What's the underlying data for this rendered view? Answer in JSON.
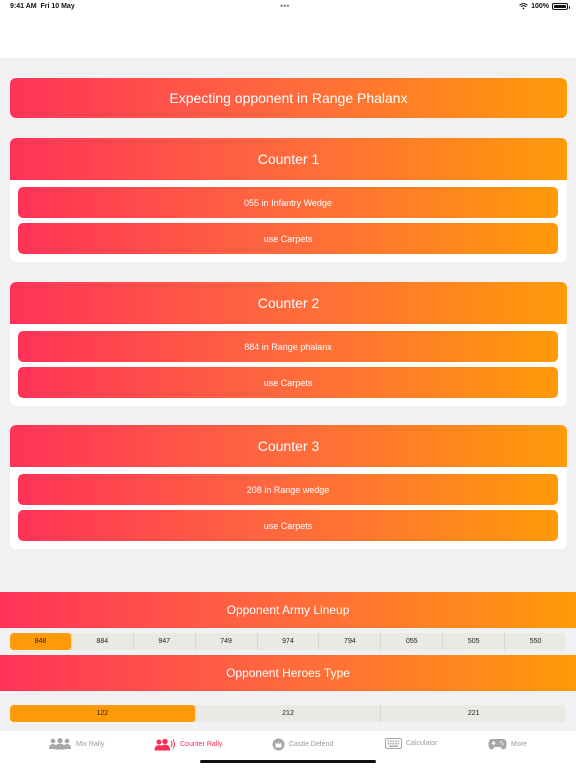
{
  "status": {
    "time": "9:41 AM",
    "date": "Fri 10 May",
    "battery": "100%"
  },
  "expecting": "Expecting opponent in Range Phalanx",
  "counters": [
    {
      "title": "Counter 1",
      "items": [
        "055 in Infantry Wedge",
        "use Carpets"
      ]
    },
    {
      "title": "Counter 2",
      "items": [
        "884 in Range phalanx",
        "use Carpets"
      ]
    },
    {
      "title": "Counter 3",
      "items": [
        "208 in Range wedge",
        "use Carpets"
      ]
    }
  ],
  "lineup": {
    "title": "Opponent Army Lineup",
    "options": [
      "848",
      "884",
      "947",
      "749",
      "974",
      "794",
      "055",
      "505",
      "550"
    ],
    "selected": "848"
  },
  "heroes": {
    "title": "Opponent Heroes Type",
    "options": [
      "122",
      "212",
      "221"
    ],
    "selected": "122"
  },
  "tabs": [
    {
      "label": "Mix Rally",
      "icon": "group-icon",
      "active": false
    },
    {
      "label": "Counter Rally",
      "icon": "group-broadcast-icon",
      "active": true
    },
    {
      "label": "Castle Defend",
      "icon": "castle-badge-icon",
      "active": false
    },
    {
      "label": "Calculator",
      "icon": "keyboard-icon",
      "active": false
    },
    {
      "label": "More",
      "icon": "gamepad-icon",
      "active": false
    }
  ],
  "colors": {
    "accent": "#ff2d55",
    "gradient_start": "#ff3358",
    "gradient_end": "#ff9a08",
    "segment_active": "#ff9a08"
  }
}
